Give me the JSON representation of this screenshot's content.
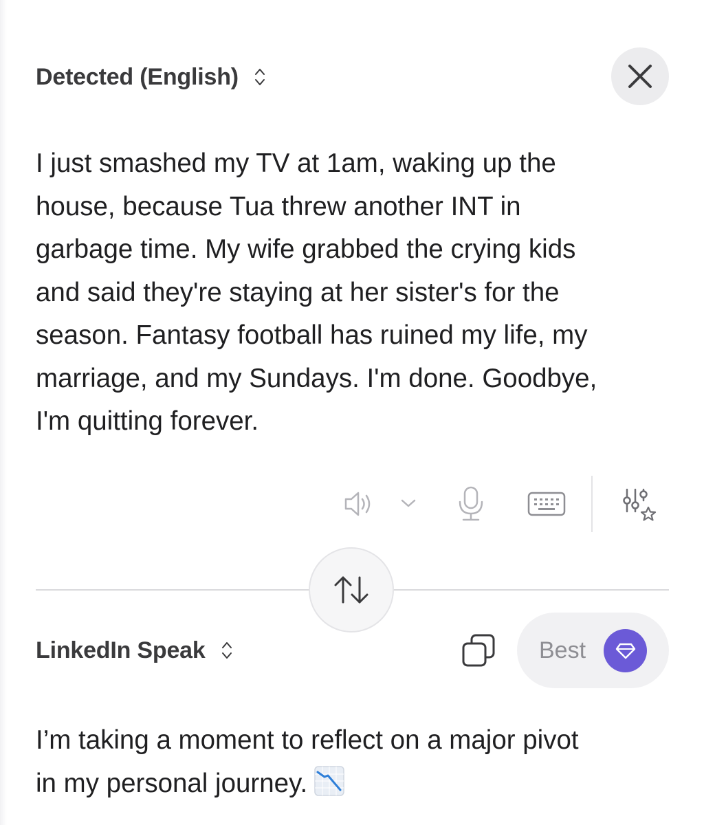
{
  "source_panel": {
    "language_label": "Detected (English)",
    "text_lines": [
      "I just smashed my TV at 1am, waking up the",
      "house, because Tua threw another INT in",
      "garbage time. My wife grabbed the crying kids",
      "and said they're staying at her sister's for the",
      "season. Fantasy football has ruined my life, my",
      "marriage, and my Sundays. I'm done. Goodbye,",
      "I'm quitting forever."
    ],
    "toolbar_icons": [
      "speaker-icon",
      "chevron-down-icon",
      "microphone-icon",
      "keyboard-icon",
      "sliders-star-icon"
    ],
    "close_icon": "close-icon"
  },
  "swap": {
    "icon": "swap-arrows-icon"
  },
  "target_panel": {
    "language_label": "LinkedIn Speak",
    "quality_label": "Best",
    "quality_icon": "gem-icon",
    "copy_icon": "copy-icon",
    "text_lines": [
      "I’m taking a moment to reflect on a major pivot",
      "in my personal journey."
    ],
    "trailing_emoji": "chart-decreasing-icon"
  },
  "colors": {
    "accent": "#6b5ad7",
    "text": "#1f1f21",
    "muted": "#8e8e93",
    "button_bg": "#ececee"
  }
}
